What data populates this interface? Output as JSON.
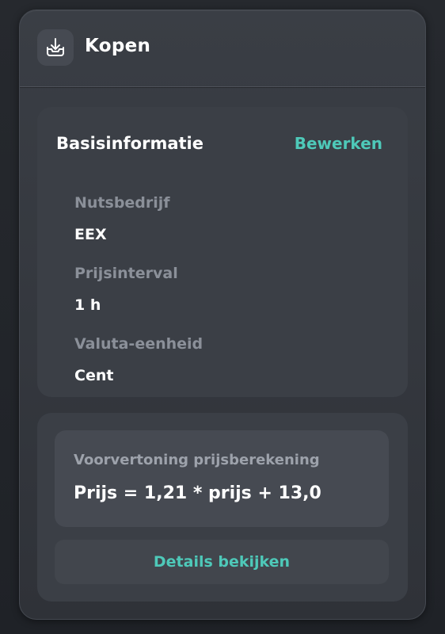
{
  "header": {
    "title": "Kopen",
    "icon": "download-tray-icon"
  },
  "basic_info": {
    "title": "Basisinformatie",
    "edit_label": "Bewerken",
    "fields": [
      {
        "label": "Nutsbedrijf",
        "value": "EEX"
      },
      {
        "label": "Prijsinterval",
        "value": "1 h"
      },
      {
        "label": "Valuta-eenheid",
        "value": "Cent"
      }
    ]
  },
  "preview": {
    "label": "Voorvertoning prijsberekening",
    "formula": "Prijs = 1,21 * prijs + 13,0",
    "details_label": "Details bekijken"
  },
  "colors": {
    "accent": "#4ec9b9",
    "panel": "#34383e",
    "card": "#3b3f46"
  }
}
